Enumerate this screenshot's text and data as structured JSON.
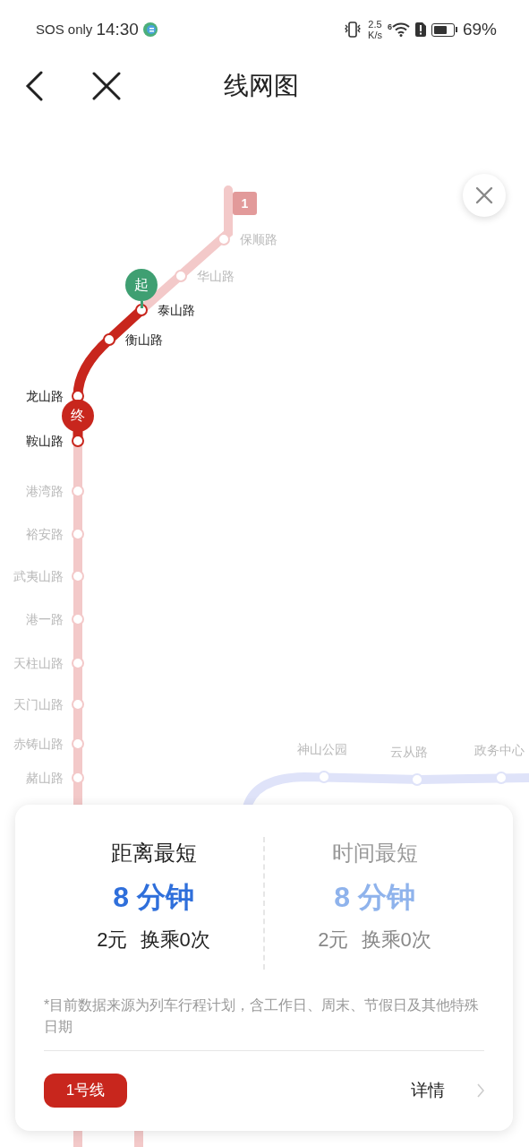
{
  "status_bar": {
    "carrier": "SOS only",
    "time": "14:30",
    "speed": "2.5",
    "speed_unit": "K/s",
    "wifi_gen": "6",
    "battery": "69%"
  },
  "header": {
    "title": "线网图"
  },
  "map": {
    "lines": [
      {
        "badge": "1",
        "color": "#f3c9c9",
        "stations": [
          {
            "name": "保顺路",
            "on_route": false
          },
          {
            "name": "华山路",
            "on_route": false
          },
          {
            "name": "泰山路",
            "on_route": true
          },
          {
            "name": "衡山路",
            "on_route": true
          },
          {
            "name": "龙山路",
            "on_route": true
          },
          {
            "name": "鞍山路",
            "on_route": true
          },
          {
            "name": "港湾路",
            "on_route": false
          },
          {
            "name": "裕安路",
            "on_route": false
          },
          {
            "name": "武夷山路",
            "on_route": false
          },
          {
            "name": "港一路",
            "on_route": false
          },
          {
            "name": "天柱山路",
            "on_route": false
          },
          {
            "name": "天门山路",
            "on_route": false
          },
          {
            "name": "赤铸山路",
            "on_route": false
          },
          {
            "name": "赭山路",
            "on_route": false
          }
        ]
      },
      {
        "color": "#dfe3f9",
        "stations": [
          {
            "name": "神山公园",
            "on_route": false
          },
          {
            "name": "云从路",
            "on_route": false
          },
          {
            "name": "政务中心",
            "on_route": false
          }
        ]
      }
    ],
    "start_marker": "起",
    "end_marker": "终"
  },
  "card": {
    "options": [
      {
        "title": "距离最短",
        "duration": "8 分钟",
        "fare": "2元",
        "transfers": "换乘0次",
        "selected": true
      },
      {
        "title": "时间最短",
        "duration": "8 分钟",
        "fare": "2元",
        "transfers": "换乘0次",
        "selected": false
      }
    ],
    "note": "*目前数据来源为列车行程计划，含工作日、周末、节假日及其他特殊日期",
    "line_tag": "1号线",
    "details": "详情"
  }
}
